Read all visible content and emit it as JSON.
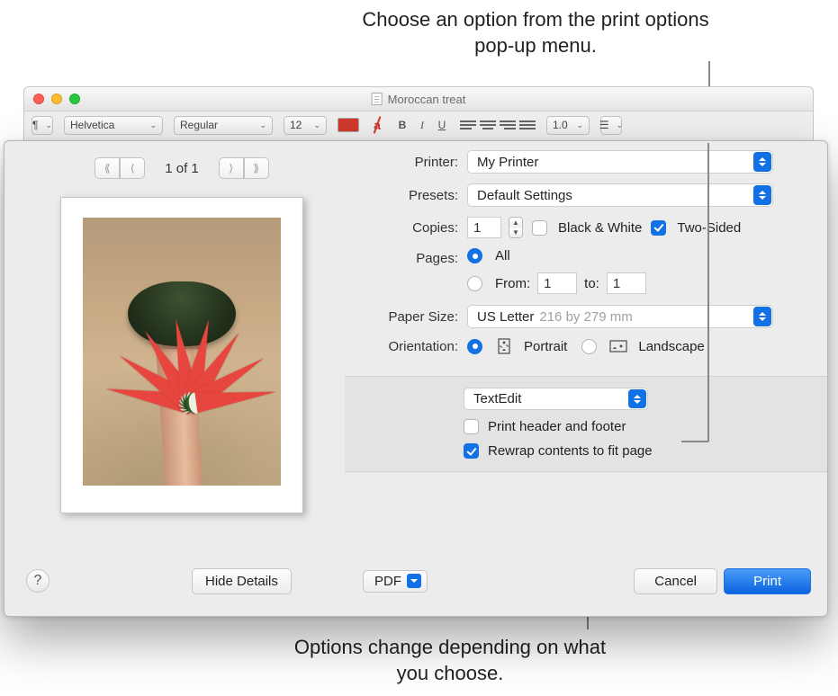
{
  "callouts": {
    "top": "Choose an option from the print options pop-up menu.",
    "bottom": "Options change depending on what you choose."
  },
  "editor": {
    "title": "Moroccan treat",
    "toolbar": {
      "paragraph_glyph": "¶",
      "font": "Helvetica",
      "style": "Regular",
      "size": "12",
      "highlight_letter": "a",
      "bold": "B",
      "italic": "I",
      "underline": "U",
      "spacing": "1.0"
    }
  },
  "print": {
    "labels": {
      "printer": "Printer:",
      "presets": "Presets:",
      "copies": "Copies:",
      "pages": "Pages:",
      "paper_size": "Paper Size:",
      "orientation": "Orientation:",
      "from_text": "From:",
      "to_text": "to:"
    },
    "printer": "My Printer",
    "presets": "Default Settings",
    "copies": "1",
    "black_white": "Black & White",
    "two_sided": "Two-Sided",
    "pages_all": "All",
    "pages_from_value": "1",
    "pages_to_value": "1",
    "paper_size_name": "US Letter",
    "paper_size_dim": "216 by 279 mm",
    "orientation_portrait": "Portrait",
    "orientation_landscape": "Landscape",
    "options_menu": "TextEdit",
    "opt_header_footer": "Print header and footer",
    "opt_rewrap": "Rewrap contents to fit page",
    "preview": {
      "page_counter": "1 of 1"
    },
    "footer": {
      "help": "?",
      "hide_details": "Hide Details",
      "pdf": "PDF",
      "cancel": "Cancel",
      "print": "Print"
    }
  }
}
